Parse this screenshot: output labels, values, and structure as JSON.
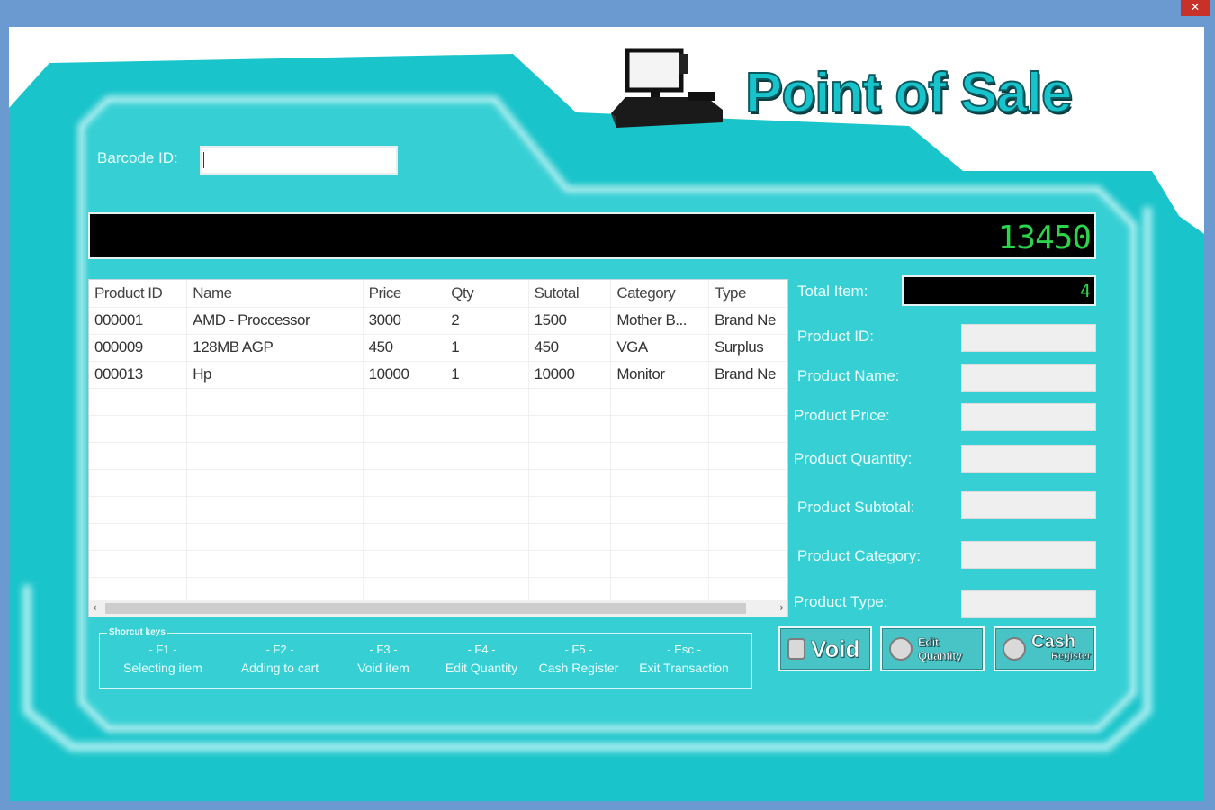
{
  "app": {
    "title": "Point of Sale",
    "logo_icon": "cash-register-terminal-icon",
    "close_icon": "close-icon"
  },
  "barcode": {
    "label": "Barcode ID:",
    "value": ""
  },
  "total_display": {
    "value": "13450"
  },
  "grid": {
    "columns": [
      "Product ID",
      "Name",
      "Price",
      "Qty",
      "Sutotal",
      "Category",
      "Type"
    ],
    "rows": [
      [
        "000001",
        "AMD - Proccessor",
        "3000",
        "2",
        "1500",
        "Mother B...",
        "Brand Ne"
      ],
      [
        "000009",
        "128MB AGP",
        "450",
        "1",
        "450",
        "VGA",
        "Surplus"
      ],
      [
        "000013",
        "Hp",
        "10000",
        "1",
        "10000",
        "Monitor",
        "Brand Ne"
      ]
    ],
    "scroll_left": "‹",
    "scroll_right": "›"
  },
  "details": {
    "total_item_label": "Total Item:",
    "total_item_value": "4",
    "product_id_label": "Product ID:",
    "product_name_label": "Product Name:",
    "product_price_label": "Product Price:",
    "product_quantity_label": "Product Quantity:",
    "product_subtotal_label": "Product Subtotal:",
    "product_category_label": "Product Category:",
    "product_type_label": "Product Type:"
  },
  "shortcuts": {
    "title": "Shorcut keys",
    "items": [
      {
        "key": "- F1 -",
        "desc": "Selecting item"
      },
      {
        "key": "- F2 -",
        "desc": "Adding to cart"
      },
      {
        "key": "- F3 -",
        "desc": "Void item"
      },
      {
        "key": "- F4 -",
        "desc": "Edit Quantity"
      },
      {
        "key": "- F5 -",
        "desc": "Cash Register"
      },
      {
        "key": "- Esc -",
        "desc": "Exit Transaction"
      }
    ]
  },
  "buttons": {
    "void": "Void",
    "edit_quantity": "Edit Quantity",
    "cash": "Cash",
    "register": "Register"
  },
  "colors": {
    "teal": "#19c4ca",
    "display_text": "#2bd44a",
    "display_bg": "#000000"
  }
}
